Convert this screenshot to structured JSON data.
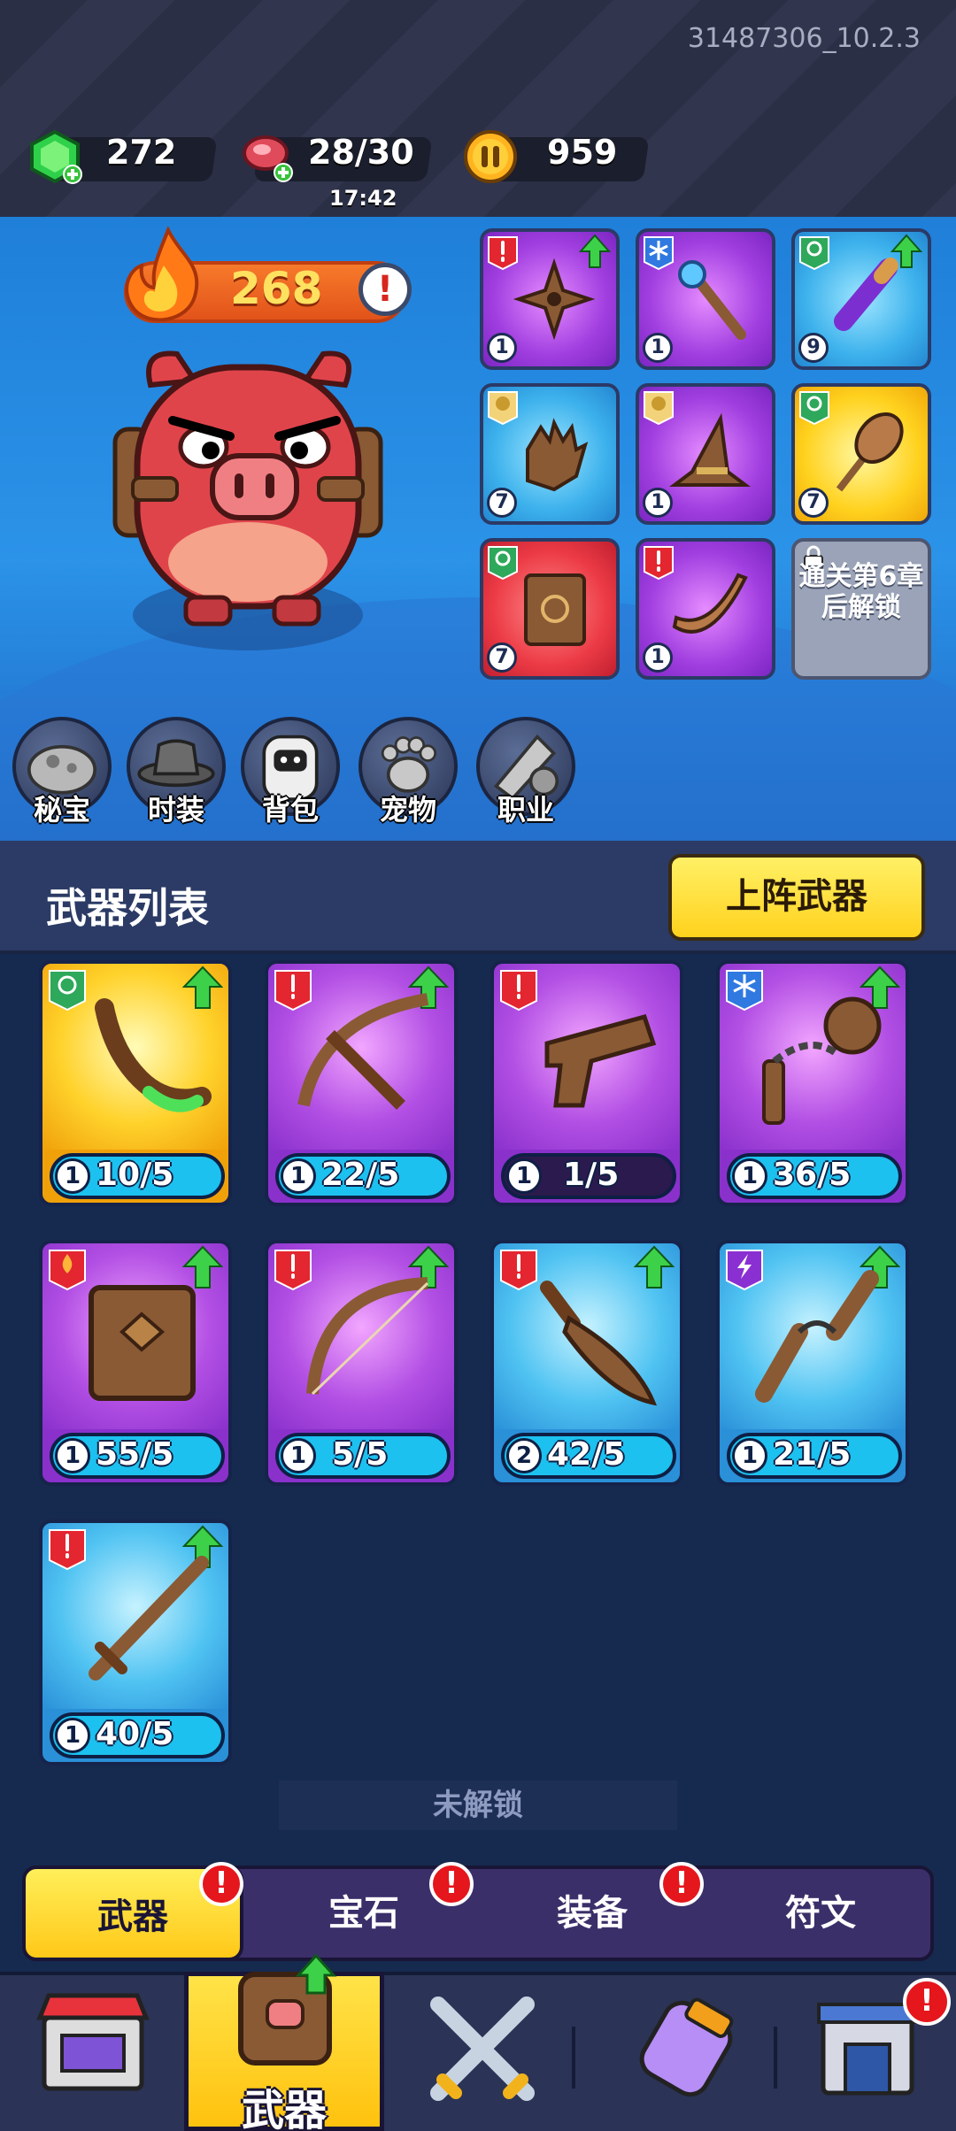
{
  "version": "31487306_10.2.3",
  "resources": {
    "gems": "272",
    "stamina": "28/30",
    "stamina_timer": "17:42",
    "coins": "959"
  },
  "hero": {
    "power": "268",
    "alert": "!",
    "equip_slots": [
      {
        "level": "1"
      },
      {
        "level": "1"
      },
      {
        "level": "9"
      },
      {
        "level": "7"
      },
      {
        "level": "1"
      },
      {
        "level": "7"
      },
      {
        "level": "7"
      },
      {
        "level": "1"
      }
    ],
    "locked_slot_text": "通关第6章后解锁"
  },
  "menu": {
    "treasure": "秘宝",
    "fashion": "时装",
    "backpack": "背包",
    "pet": "宠物",
    "class": "职业"
  },
  "weapon_list": {
    "title": "武器列表",
    "deploy_button": "上阵武器",
    "cards": [
      {
        "level": "1",
        "progress": "10/5"
      },
      {
        "level": "1",
        "progress": "22/5"
      },
      {
        "level": "1",
        "progress": "1/5"
      },
      {
        "level": "1",
        "progress": "36/5"
      },
      {
        "level": "1",
        "progress": "55/5"
      },
      {
        "level": "1",
        "progress": "5/5"
      },
      {
        "level": "2",
        "progress": "42/5"
      },
      {
        "level": "1",
        "progress": "21/5"
      },
      {
        "level": "1",
        "progress": "40/5"
      }
    ],
    "locked_label": "未解锁"
  },
  "tabs": {
    "weapon": "武器",
    "gem": "宝石",
    "equipment": "装备",
    "rune": "符文",
    "alert": "!"
  },
  "bottom_nav": {
    "active_label": "武器",
    "alert": "!"
  },
  "colors": {
    "accent_yellow": "#ffd21d",
    "alert_red": "#e5161c",
    "progress_cyan": "#1cc1ef"
  }
}
